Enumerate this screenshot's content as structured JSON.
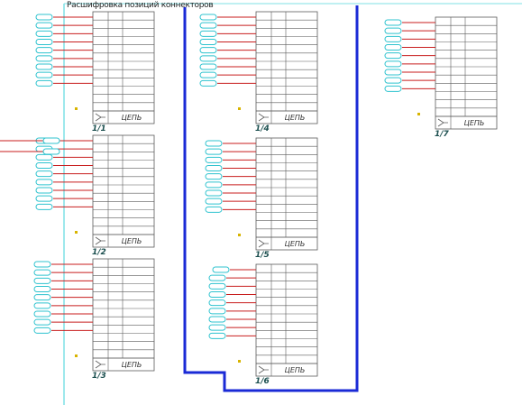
{
  "diagram": {
    "title": "Расшифровка позиций коннекторов",
    "colors": {
      "bus": "#1a2ad6",
      "ground": "#7fe0e6",
      "wire": "#c81e1e",
      "connector": "#2fc3cf",
      "block": "#5b5b5b",
      "label": "#1b4f4f",
      "marker": "#d8b400"
    },
    "ports": [
      {
        "label": "1/1",
        "footer": "ЦЕПЬ",
        "pins": 9
      },
      {
        "label": "1/2",
        "footer": "ЦЕПЬ",
        "pins": 9
      },
      {
        "label": "1/3",
        "footer": "ЦЕПЬ",
        "pins": 9
      },
      {
        "label": "1/4",
        "footer": "ЦЕПЬ",
        "pins": 9
      },
      {
        "label": "1/5",
        "footer": "ЦЕПЬ",
        "pins": 9
      },
      {
        "label": "1/6",
        "footer": "ЦЕПЬ",
        "pins": 9
      },
      {
        "label": "1/7",
        "footer": "ЦЕПЬ",
        "pins": 9
      }
    ]
  }
}
